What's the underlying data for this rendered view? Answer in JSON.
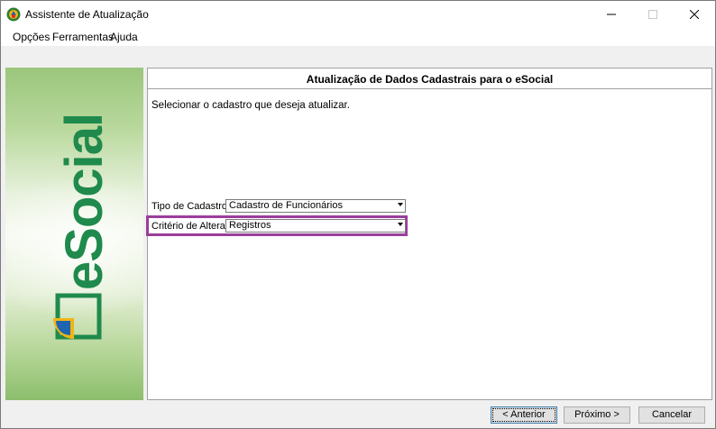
{
  "window": {
    "title": "Assistente de Atualização",
    "controls": {
      "minimize": "—",
      "maximize": "☐",
      "close": "✕"
    }
  },
  "menu": {
    "items": [
      "Opções",
      "Ferramentas",
      "Ajuda"
    ]
  },
  "side_panel": {
    "logo_text": "eSocial",
    "colors": {
      "green": "#1f8a4c",
      "light_green": "#9bc67c",
      "yellow": "#f2b416",
      "blue": "#1e64b0"
    }
  },
  "content": {
    "title": "Atualização de Dados Cadastrais para o eSocial",
    "instruction": "Selecionar o cadastro que deseja atualizar.",
    "tipo_cadastro": {
      "label": "Tipo de Cadastro:",
      "value": "Cadastro de Funcionários"
    },
    "criterio": {
      "label": "Critério de Alteração:",
      "value": "Registros"
    },
    "highlight_color": "#9b3d9b"
  },
  "buttons": {
    "back": "< Anterior",
    "next": "Próximo >",
    "cancel": "Cancelar"
  }
}
